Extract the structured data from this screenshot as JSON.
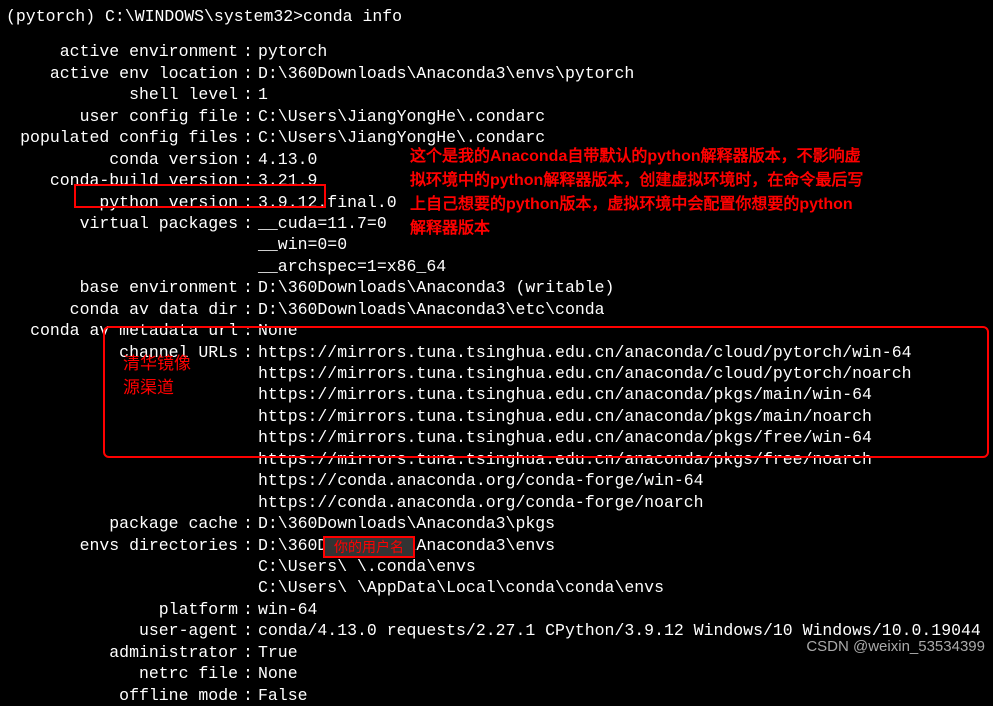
{
  "prompt": "(pytorch) C:\\WINDOWS\\system32>conda info",
  "rows": {
    "active_env_label": "active environment",
    "active_env": "pytorch",
    "env_loc_label": "active env location",
    "env_loc": "D:\\360Downloads\\Anaconda3\\envs\\pytorch",
    "shell_level_label": "shell level",
    "shell_level": "1",
    "user_cfg_label": "user config file",
    "user_cfg": "C:\\Users\\JiangYongHe\\.condarc",
    "pop_cfg_label": "populated config files",
    "pop_cfg": "C:\\Users\\JiangYongHe\\.condarc",
    "conda_ver_label": "conda version",
    "conda_ver": "4.13.0",
    "build_ver_label": "conda-build version",
    "build_ver": "3.21.9",
    "py_ver_label": "python version",
    "py_ver": "3.9.12.final.0",
    "vpkg_label": "virtual packages",
    "vpkg1": "__cuda=11.7=0",
    "vpkg2": "__win=0=0",
    "vpkg3": "__archspec=1=x86_64",
    "base_env_label": "base environment",
    "base_env": "D:\\360Downloads\\Anaconda3  (writable)",
    "av_data_label": "conda av data dir",
    "av_data": "D:\\360Downloads\\Anaconda3\\etc\\conda",
    "av_meta_label": "conda av metadata url",
    "av_meta": "None",
    "ch_label": "channel URLs",
    "ch1": "https://mirrors.tuna.tsinghua.edu.cn/anaconda/cloud/pytorch/win-64",
    "ch2": "https://mirrors.tuna.tsinghua.edu.cn/anaconda/cloud/pytorch/noarch",
    "ch3": "https://mirrors.tuna.tsinghua.edu.cn/anaconda/pkgs/main/win-64",
    "ch4": "https://mirrors.tuna.tsinghua.edu.cn/anaconda/pkgs/main/noarch",
    "ch5": "https://mirrors.tuna.tsinghua.edu.cn/anaconda/pkgs/free/win-64",
    "ch6": "https://mirrors.tuna.tsinghua.edu.cn/anaconda/pkgs/free/noarch",
    "ch7": "https://conda.anaconda.org/conda-forge/win-64",
    "ch8": "https://conda.anaconda.org/conda-forge/noarch",
    "pkg_cache_label": "package cache",
    "pkg_cache": "D:\\360Downloads\\Anaconda3\\pkgs",
    "envs_dir_label": "envs directories",
    "envs_dir1": "D:\\360Downloads\\Anaconda3\\envs",
    "envs_dir2": "C:\\Users\\            \\.conda\\envs",
    "envs_dir3": "C:\\Users\\            \\AppData\\Local\\conda\\conda\\envs",
    "platform_label": "platform",
    "platform": "win-64",
    "ua_label": "user-agent",
    "ua": "conda/4.13.0 requests/2.27.1 CPython/3.9.12 Windows/10 Windows/10.0.19044",
    "admin_label": "administrator",
    "admin": "True",
    "netrc_label": "netrc file",
    "netrc": "None",
    "offline_label": "offline mode",
    "offline": "False"
  },
  "annotation": {
    "py_note_l1": "这个是我的Anaconda自带默认的python解释器版本，不影响虚",
    "py_note_l2": "拟环境中的python解释器版本，创建虚拟环境时，在命令最后写",
    "py_note_l3": "上自己想要的python版本，虚拟环境中会配置你想要的python",
    "py_note_l4": "解释器版本",
    "channel_note_l1": "清华镜像",
    "channel_note_l2": "源渠道",
    "user_mask": "你的用户名"
  },
  "watermark": "CSDN @weixin_53534399"
}
